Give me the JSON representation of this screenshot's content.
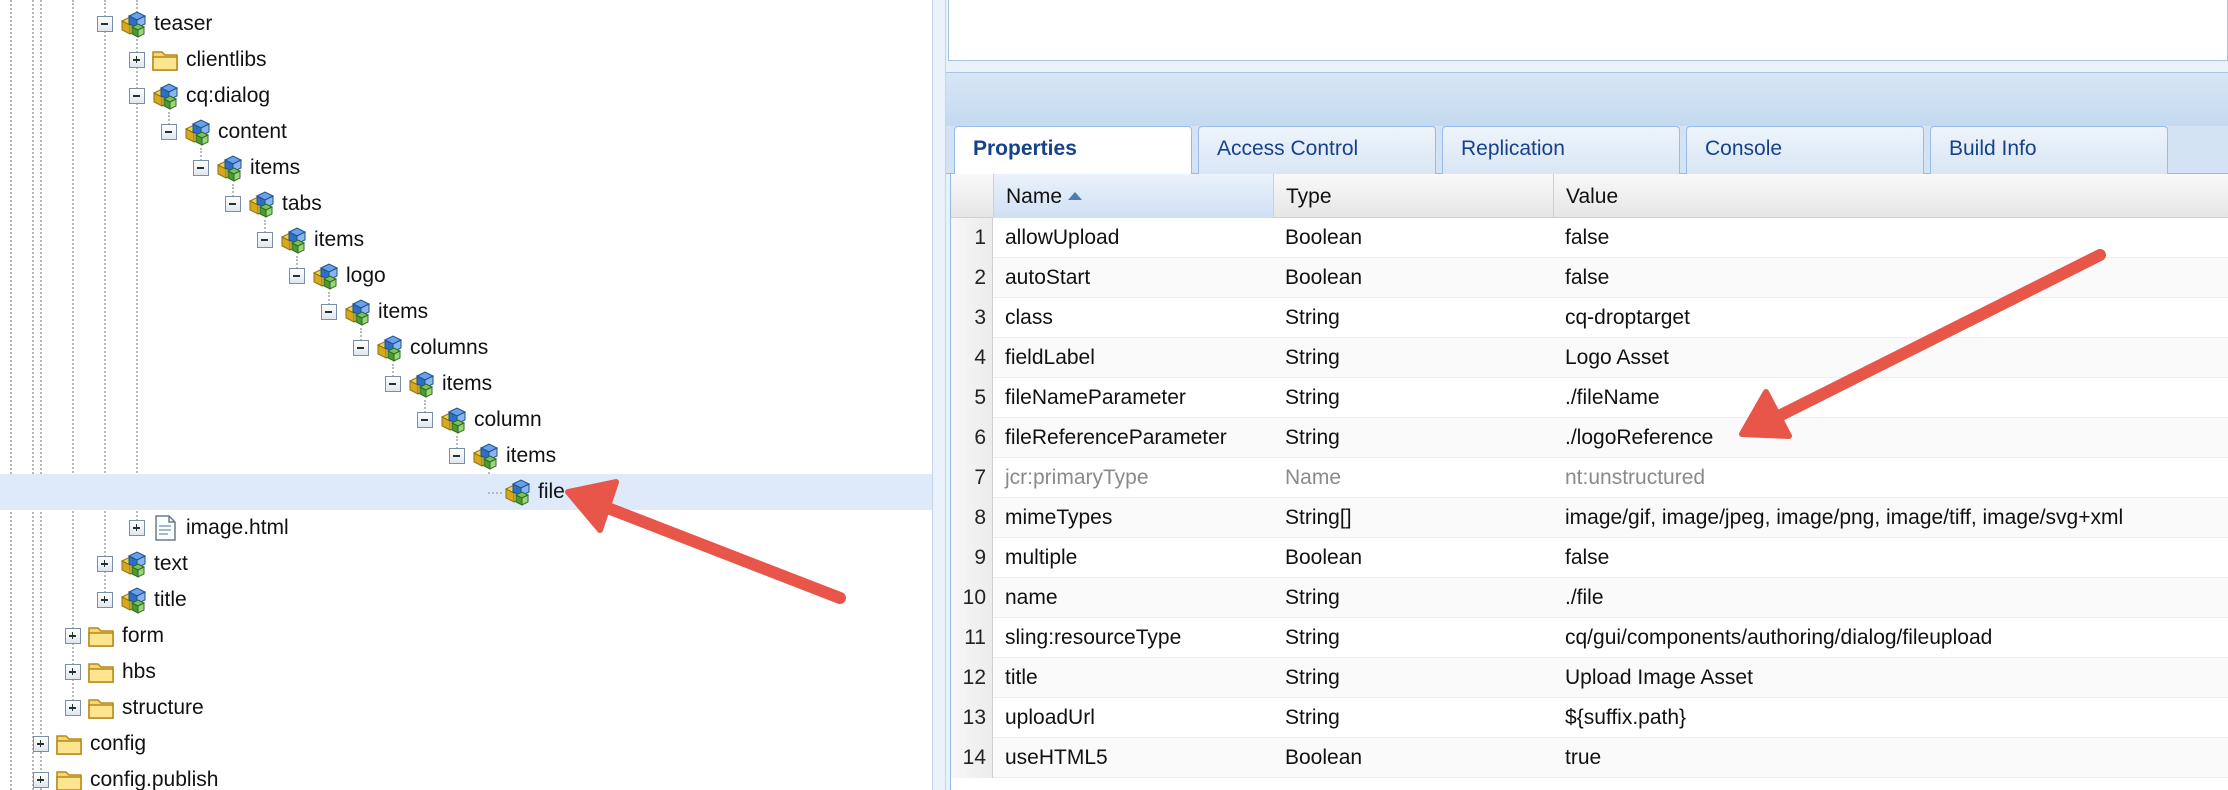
{
  "tree": {
    "nodes": [
      {
        "label": "teaser",
        "level": 3,
        "toggle": "minus",
        "icon": "component-node-icon"
      },
      {
        "label": "clientlibs",
        "level": 4,
        "toggle": "plus",
        "icon": "folder-icon"
      },
      {
        "label": "cq:dialog",
        "level": 4,
        "toggle": "minus",
        "icon": "component-node-icon"
      },
      {
        "label": "content",
        "level": 5,
        "toggle": "minus",
        "icon": "component-node-icon"
      },
      {
        "label": "items",
        "level": 6,
        "toggle": "minus",
        "icon": "component-node-icon"
      },
      {
        "label": "tabs",
        "level": 7,
        "toggle": "minus",
        "icon": "component-node-icon"
      },
      {
        "label": "items",
        "level": 8,
        "toggle": "minus",
        "icon": "component-node-icon"
      },
      {
        "label": "logo",
        "level": 9,
        "toggle": "minus",
        "icon": "component-node-icon"
      },
      {
        "label": "items",
        "level": 10,
        "toggle": "minus",
        "icon": "component-node-icon"
      },
      {
        "label": "columns",
        "level": 11,
        "toggle": "minus",
        "icon": "component-node-icon"
      },
      {
        "label": "items",
        "level": 12,
        "toggle": "minus",
        "icon": "component-node-icon"
      },
      {
        "label": "column",
        "level": 13,
        "toggle": "minus",
        "icon": "component-node-icon"
      },
      {
        "label": "items",
        "level": 14,
        "toggle": "minus",
        "icon": "component-node-icon"
      },
      {
        "label": "file",
        "level": 15,
        "toggle": "none",
        "icon": "component-node-icon",
        "selected": true
      },
      {
        "label": "image.html",
        "level": 4,
        "toggle": "plus",
        "icon": "file-icon"
      },
      {
        "label": "text",
        "level": 3,
        "toggle": "plus",
        "icon": "component-node-icon"
      },
      {
        "label": "title",
        "level": 3,
        "toggle": "plus",
        "icon": "component-node-icon"
      },
      {
        "label": "form",
        "level": 2,
        "toggle": "plus",
        "icon": "folder-icon"
      },
      {
        "label": "hbs",
        "level": 2,
        "toggle": "plus",
        "icon": "folder-icon"
      },
      {
        "label": "structure",
        "level": 2,
        "toggle": "plus",
        "icon": "folder-icon"
      },
      {
        "label": "config",
        "level": 1,
        "toggle": "plus",
        "icon": "folder-icon"
      },
      {
        "label": "config.publish",
        "level": 1,
        "toggle": "plus",
        "icon": "folder-icon"
      }
    ]
  },
  "tabs": [
    {
      "label": "Properties",
      "active": true
    },
    {
      "label": "Access Control",
      "active": false
    },
    {
      "label": "Replication",
      "active": false
    },
    {
      "label": "Console",
      "active": false
    },
    {
      "label": "Build Info",
      "active": false
    }
  ],
  "grid": {
    "columns": {
      "name": "Name",
      "type": "Type",
      "value": "Value"
    },
    "sorted_column": "name",
    "sort_direction": "ascending",
    "rows": [
      {
        "num": "1",
        "name": "allowUpload",
        "type": "Boolean",
        "value": "false"
      },
      {
        "num": "2",
        "name": "autoStart",
        "type": "Boolean",
        "value": "false"
      },
      {
        "num": "3",
        "name": "class",
        "type": "String",
        "value": "cq-droptarget"
      },
      {
        "num": "4",
        "name": "fieldLabel",
        "type": "String",
        "value": "Logo Asset"
      },
      {
        "num": "5",
        "name": "fileNameParameter",
        "type": "String",
        "value": "./fileName"
      },
      {
        "num": "6",
        "name": "fileReferenceParameter",
        "type": "String",
        "value": "./logoReference"
      },
      {
        "num": "7",
        "name": "jcr:primaryType",
        "type": "Name",
        "value": "nt:unstructured",
        "muted": true
      },
      {
        "num": "8",
        "name": "mimeTypes",
        "type": "String[]",
        "value": "image/gif, image/jpeg, image/png, image/tiff, image/svg+xml"
      },
      {
        "num": "9",
        "name": "multiple",
        "type": "Boolean",
        "value": "false"
      },
      {
        "num": "10",
        "name": "name",
        "type": "String",
        "value": "./file"
      },
      {
        "num": "11",
        "name": "sling:resourceType",
        "type": "String",
        "value": "cq/gui/components/authoring/dialog/fileupload"
      },
      {
        "num": "12",
        "name": "title",
        "type": "String",
        "value": "Upload Image Asset"
      },
      {
        "num": "13",
        "name": "uploadUrl",
        "type": "String",
        "value": "${suffix.path}"
      },
      {
        "num": "14",
        "name": "useHTML5",
        "type": "Boolean",
        "value": "true"
      }
    ]
  },
  "annotation": {
    "arrow_color": "#e8564a"
  }
}
